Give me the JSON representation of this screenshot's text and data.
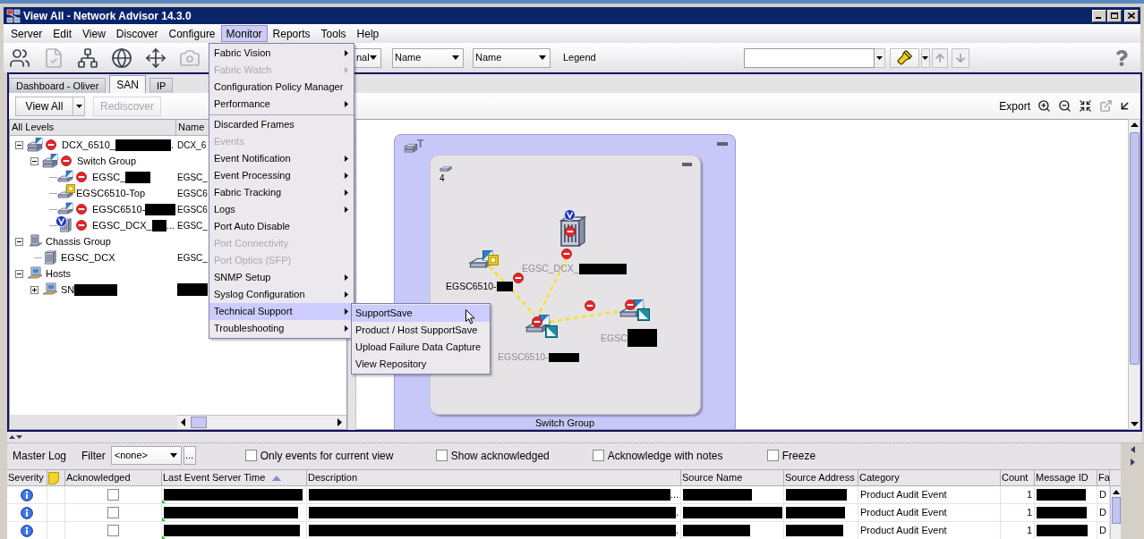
{
  "window": {
    "title": "View All - Network Advisor 14.3.0"
  },
  "menu_bar": [
    {
      "label": "Server",
      "selected": false
    },
    {
      "label": "Edit",
      "selected": false
    },
    {
      "label": "View",
      "selected": false
    },
    {
      "label": "Discover",
      "selected": false
    },
    {
      "label": "Configure",
      "selected": false
    },
    {
      "label": "Monitor",
      "selected": true
    },
    {
      "label": "Reports",
      "selected": false
    },
    {
      "label": "Tools",
      "selected": false
    },
    {
      "label": "Help",
      "selected": false
    }
  ],
  "toolbar": {
    "buttons": [
      {
        "kind": "users",
        "disabled": false
      },
      {
        "kind": "document",
        "disabled": true
      },
      {
        "kind": "network",
        "disabled": false
      },
      {
        "kind": "globe",
        "disabled": false
      },
      {
        "kind": "move",
        "disabled": false
      },
      {
        "kind": "camera",
        "disabled": true
      }
    ],
    "combos": [
      {
        "value": "nal"
      },
      {
        "value": "Name"
      },
      {
        "value": "Name"
      }
    ],
    "legend": "Legend"
  },
  "tabs": [
    {
      "label": "Dashboard - Oliver",
      "selected": false
    },
    {
      "label": "SAN",
      "selected": true
    },
    {
      "label": "IP",
      "selected": false
    }
  ],
  "view_bar": {
    "view_button": "View All",
    "rediscover": {
      "label": "Rediscover",
      "disabled": true
    },
    "export": "Export"
  },
  "tree": {
    "columns": [
      "All Levels",
      "Name"
    ],
    "items": [
      {
        "kind": "fabric",
        "error": true,
        "marginal": false,
        "label": "DCX_6510_",
        "redacted": true,
        "tail": ".",
        "name": "DCX_6",
        "expanded": true,
        "children": [
          {
            "kind": "switch-group",
            "error": true,
            "marginal": false,
            "label": "Switch Group",
            "redacted": false,
            "expanded": true,
            "children": [
              {
                "kind": "switch",
                "error": true,
                "marginal": false,
                "label": "EGSC_",
                "redacted": true,
                "name": "EGSC_"
              },
              {
                "kind": "switch",
                "error": false,
                "marginal": true,
                "label": "EGSC6510-Top",
                "redacted": false,
                "name": "EGSC6"
              },
              {
                "kind": "switch",
                "error": true,
                "marginal": false,
                "label": "EGSC6510-",
                "redacted": true,
                "name": "EGSC6"
              },
              {
                "kind": "chassis",
                "virtual": true,
                "error": true,
                "marginal": false,
                "label": "EGSC_DCX_",
                "redacted": true,
                "tail": "...",
                "name": "EGSC_"
              }
            ]
          }
        ]
      },
      {
        "kind": "chassis-group",
        "error": false,
        "marginal": false,
        "label": "Chassis Group",
        "redacted": false,
        "expanded": true,
        "children": [
          {
            "kind": "chassis",
            "virtual": false,
            "error": false,
            "marginal": false,
            "label": "EGSC_DCX",
            "redacted": false,
            "name": "EGSC_"
          }
        ]
      },
      {
        "kind": "hosts",
        "error": false,
        "marginal": false,
        "label": "Hosts",
        "redacted": false,
        "expanded": true,
        "children": [
          {
            "kind": "host",
            "error": false,
            "marginal": false,
            "label": "SN",
            "redacted": true,
            "name_redacted": true,
            "expanded": false
          }
        ]
      }
    ]
  },
  "topology": {
    "group": {
      "title": "T",
      "label": "Switch Group"
    },
    "subgroup": {
      "count": "4"
    },
    "nodes": [
      {
        "kind": "switch",
        "label": "EGSC6510-",
        "redacted": true,
        "dimmed": false,
        "error": false,
        "marginal": true,
        "flag": false
      },
      {
        "kind": "chassis",
        "virtual": true,
        "label": "EGSC_DCX_",
        "redacted": true,
        "dimmed": true,
        "error": true,
        "marginal": false
      },
      {
        "kind": "switch",
        "label": "EGSC6510-",
        "redacted": true,
        "dimmed": true,
        "error": true,
        "marginal": false,
        "flag": true
      },
      {
        "kind": "switch",
        "label": "EGSC",
        "redacted": true,
        "dimmed": true,
        "error": true,
        "marginal": false,
        "flag": true
      }
    ],
    "links": [
      {
        "error": true
      },
      {
        "error": true
      },
      {
        "error": true
      }
    ]
  },
  "monitor_menu": {
    "items": [
      {
        "kind": "item",
        "label": "Fabric Vision",
        "submenu": true,
        "disabled": false,
        "selected": false
      },
      {
        "kind": "item",
        "label": "Fabric Watch",
        "submenu": true,
        "disabled": true,
        "selected": false
      },
      {
        "kind": "item",
        "label": "Configuration Policy Manager",
        "submenu": false,
        "disabled": false,
        "selected": false
      },
      {
        "kind": "item",
        "label": "Performance",
        "submenu": true,
        "disabled": false,
        "selected": false
      },
      {
        "kind": "separator"
      },
      {
        "kind": "item",
        "label": "Discarded Frames",
        "submenu": false,
        "disabled": false,
        "selected": false
      },
      {
        "kind": "item",
        "label": "Events",
        "submenu": false,
        "disabled": true,
        "selected": false
      },
      {
        "kind": "item",
        "label": "Event Notification",
        "submenu": true,
        "disabled": false,
        "selected": false
      },
      {
        "kind": "item",
        "label": "Event Processing",
        "submenu": true,
        "disabled": false,
        "selected": false
      },
      {
        "kind": "item",
        "label": "Fabric Tracking",
        "submenu": true,
        "disabled": false,
        "selected": false
      },
      {
        "kind": "item",
        "label": "Logs",
        "submenu": true,
        "disabled": false,
        "selected": false
      },
      {
        "kind": "item",
        "label": "Port Auto Disable",
        "submenu": false,
        "disabled": false,
        "selected": false
      },
      {
        "kind": "item",
        "label": "Port Connectivity",
        "submenu": false,
        "disabled": true,
        "selected": false
      },
      {
        "kind": "item",
        "label": "Port Optics (SFP)",
        "submenu": false,
        "disabled": true,
        "selected": false
      },
      {
        "kind": "item",
        "label": "SNMP Setup",
        "submenu": true,
        "disabled": false,
        "selected": false
      },
      {
        "kind": "item",
        "label": "Syslog Configuration",
        "submenu": true,
        "disabled": false,
        "selected": false
      },
      {
        "kind": "item",
        "label": "Technical Support",
        "submenu": true,
        "disabled": false,
        "selected": true
      },
      {
        "kind": "item",
        "label": "Troubleshooting",
        "submenu": true,
        "disabled": false,
        "selected": false
      }
    ]
  },
  "submenu": {
    "items": [
      {
        "label": "SupportSave",
        "selected": true
      },
      {
        "label": "Product / Host SupportSave",
        "selected": false
      },
      {
        "label": "Upload Failure Data Capture",
        "selected": false
      },
      {
        "label": "View Repository",
        "selected": false
      }
    ]
  },
  "master_log": {
    "title": "Master Log",
    "filter_label": "Filter",
    "filter_value": "<none>",
    "more_button": "...",
    "options": [
      {
        "label": "Only events for current view",
        "checked": false
      },
      {
        "label": "Show acknowledged",
        "checked": false
      },
      {
        "label": "Acknowledge with notes",
        "checked": false
      },
      {
        "label": "Freeze",
        "checked": false
      }
    ],
    "columns": [
      {
        "kind": "text",
        "label": "Severity",
        "sorted": false
      },
      {
        "kind": "note-icon",
        "sorted": false
      },
      {
        "kind": "text",
        "label": "Acknowledged",
        "sorted": false
      },
      {
        "kind": "text",
        "label": "Last Event Server Time",
        "sorted": true
      },
      {
        "kind": "text",
        "label": "Description",
        "sorted": false
      },
      {
        "kind": "text",
        "label": "Source Name",
        "sorted": false
      },
      {
        "kind": "text",
        "label": "Source Address",
        "sorted": false
      },
      {
        "kind": "text",
        "label": "Category",
        "sorted": false
      },
      {
        "kind": "text",
        "label": "Count",
        "sorted": false
      },
      {
        "kind": "text",
        "label": "Message ID",
        "sorted": false
      },
      {
        "kind": "text",
        "label": "Fa",
        "sorted": false
      }
    ],
    "rows": [
      {
        "kind": "info",
        "acknowledged": false,
        "time": {
          "redacted": true
        },
        "description": {
          "redacted": true,
          "tail": "..."
        },
        "source_name": {
          "redacted": true
        },
        "source_address": {
          "redacted": true
        },
        "category": {
          "text": "Product Audit Event"
        },
        "count": {
          "text": "1"
        },
        "message_id": {
          "redacted": true
        },
        "column_11": {
          "text": "D"
        }
      },
      {
        "kind": "info",
        "acknowledged": false,
        "time": {
          "redacted": true
        },
        "description": {
          "redacted": true,
          "tail": "."
        },
        "source_name": {
          "redacted": true
        },
        "source_address": {
          "redacted": true
        },
        "category": {
          "text": "Product Audit Event"
        },
        "count": {
          "text": "1"
        },
        "message_id": {
          "redacted": true
        },
        "column_11": {
          "text": "D"
        }
      },
      {
        "kind": "info",
        "acknowledged": false,
        "time": {
          "redacted": true
        },
        "description": {
          "redacted": true,
          "tail": "."
        },
        "source_name": {
          "redacted": true
        },
        "source_address": {
          "redacted": true
        },
        "category": {
          "text": "Product Audit Event"
        },
        "count": {
          "text": "1"
        },
        "message_id": {
          "redacted": true
        },
        "column_11": {
          "text": "D"
        }
      }
    ]
  }
}
